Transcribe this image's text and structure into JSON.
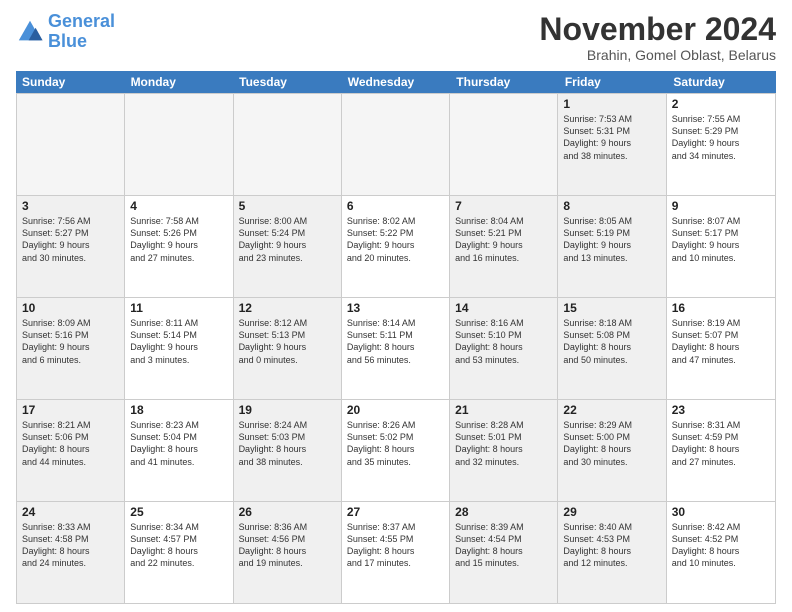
{
  "logo": {
    "line1": "General",
    "line2": "Blue"
  },
  "title": "November 2024",
  "location": "Brahin, Gomel Oblast, Belarus",
  "weekdays": [
    "Sunday",
    "Monday",
    "Tuesday",
    "Wednesday",
    "Thursday",
    "Friday",
    "Saturday"
  ],
  "rows": [
    [
      {
        "day": "",
        "info": "",
        "empty": true
      },
      {
        "day": "",
        "info": "",
        "empty": true
      },
      {
        "day": "",
        "info": "",
        "empty": true
      },
      {
        "day": "",
        "info": "",
        "empty": true
      },
      {
        "day": "",
        "info": "",
        "empty": true
      },
      {
        "day": "1",
        "info": "Sunrise: 7:53 AM\nSunset: 5:31 PM\nDaylight: 9 hours\nand 38 minutes.",
        "shaded": true
      },
      {
        "day": "2",
        "info": "Sunrise: 7:55 AM\nSunset: 5:29 PM\nDaylight: 9 hours\nand 34 minutes."
      }
    ],
    [
      {
        "day": "3",
        "info": "Sunrise: 7:56 AM\nSunset: 5:27 PM\nDaylight: 9 hours\nand 30 minutes.",
        "shaded": true
      },
      {
        "day": "4",
        "info": "Sunrise: 7:58 AM\nSunset: 5:26 PM\nDaylight: 9 hours\nand 27 minutes."
      },
      {
        "day": "5",
        "info": "Sunrise: 8:00 AM\nSunset: 5:24 PM\nDaylight: 9 hours\nand 23 minutes.",
        "shaded": true
      },
      {
        "day": "6",
        "info": "Sunrise: 8:02 AM\nSunset: 5:22 PM\nDaylight: 9 hours\nand 20 minutes."
      },
      {
        "day": "7",
        "info": "Sunrise: 8:04 AM\nSunset: 5:21 PM\nDaylight: 9 hours\nand 16 minutes.",
        "shaded": true
      },
      {
        "day": "8",
        "info": "Sunrise: 8:05 AM\nSunset: 5:19 PM\nDaylight: 9 hours\nand 13 minutes.",
        "shaded": true
      },
      {
        "day": "9",
        "info": "Sunrise: 8:07 AM\nSunset: 5:17 PM\nDaylight: 9 hours\nand 10 minutes."
      }
    ],
    [
      {
        "day": "10",
        "info": "Sunrise: 8:09 AM\nSunset: 5:16 PM\nDaylight: 9 hours\nand 6 minutes.",
        "shaded": true
      },
      {
        "day": "11",
        "info": "Sunrise: 8:11 AM\nSunset: 5:14 PM\nDaylight: 9 hours\nand 3 minutes."
      },
      {
        "day": "12",
        "info": "Sunrise: 8:12 AM\nSunset: 5:13 PM\nDaylight: 9 hours\nand 0 minutes.",
        "shaded": true
      },
      {
        "day": "13",
        "info": "Sunrise: 8:14 AM\nSunset: 5:11 PM\nDaylight: 8 hours\nand 56 minutes."
      },
      {
        "day": "14",
        "info": "Sunrise: 8:16 AM\nSunset: 5:10 PM\nDaylight: 8 hours\nand 53 minutes.",
        "shaded": true
      },
      {
        "day": "15",
        "info": "Sunrise: 8:18 AM\nSunset: 5:08 PM\nDaylight: 8 hours\nand 50 minutes.",
        "shaded": true
      },
      {
        "day": "16",
        "info": "Sunrise: 8:19 AM\nSunset: 5:07 PM\nDaylight: 8 hours\nand 47 minutes."
      }
    ],
    [
      {
        "day": "17",
        "info": "Sunrise: 8:21 AM\nSunset: 5:06 PM\nDaylight: 8 hours\nand 44 minutes.",
        "shaded": true
      },
      {
        "day": "18",
        "info": "Sunrise: 8:23 AM\nSunset: 5:04 PM\nDaylight: 8 hours\nand 41 minutes."
      },
      {
        "day": "19",
        "info": "Sunrise: 8:24 AM\nSunset: 5:03 PM\nDaylight: 8 hours\nand 38 minutes.",
        "shaded": true
      },
      {
        "day": "20",
        "info": "Sunrise: 8:26 AM\nSunset: 5:02 PM\nDaylight: 8 hours\nand 35 minutes."
      },
      {
        "day": "21",
        "info": "Sunrise: 8:28 AM\nSunset: 5:01 PM\nDaylight: 8 hours\nand 32 minutes.",
        "shaded": true
      },
      {
        "day": "22",
        "info": "Sunrise: 8:29 AM\nSunset: 5:00 PM\nDaylight: 8 hours\nand 30 minutes.",
        "shaded": true
      },
      {
        "day": "23",
        "info": "Sunrise: 8:31 AM\nSunset: 4:59 PM\nDaylight: 8 hours\nand 27 minutes."
      }
    ],
    [
      {
        "day": "24",
        "info": "Sunrise: 8:33 AM\nSunset: 4:58 PM\nDaylight: 8 hours\nand 24 minutes.",
        "shaded": true
      },
      {
        "day": "25",
        "info": "Sunrise: 8:34 AM\nSunset: 4:57 PM\nDaylight: 8 hours\nand 22 minutes."
      },
      {
        "day": "26",
        "info": "Sunrise: 8:36 AM\nSunset: 4:56 PM\nDaylight: 8 hours\nand 19 minutes.",
        "shaded": true
      },
      {
        "day": "27",
        "info": "Sunrise: 8:37 AM\nSunset: 4:55 PM\nDaylight: 8 hours\nand 17 minutes."
      },
      {
        "day": "28",
        "info": "Sunrise: 8:39 AM\nSunset: 4:54 PM\nDaylight: 8 hours\nand 15 minutes.",
        "shaded": true
      },
      {
        "day": "29",
        "info": "Sunrise: 8:40 AM\nSunset: 4:53 PM\nDaylight: 8 hours\nand 12 minutes.",
        "shaded": true
      },
      {
        "day": "30",
        "info": "Sunrise: 8:42 AM\nSunset: 4:52 PM\nDaylight: 8 hours\nand 10 minutes."
      }
    ]
  ]
}
